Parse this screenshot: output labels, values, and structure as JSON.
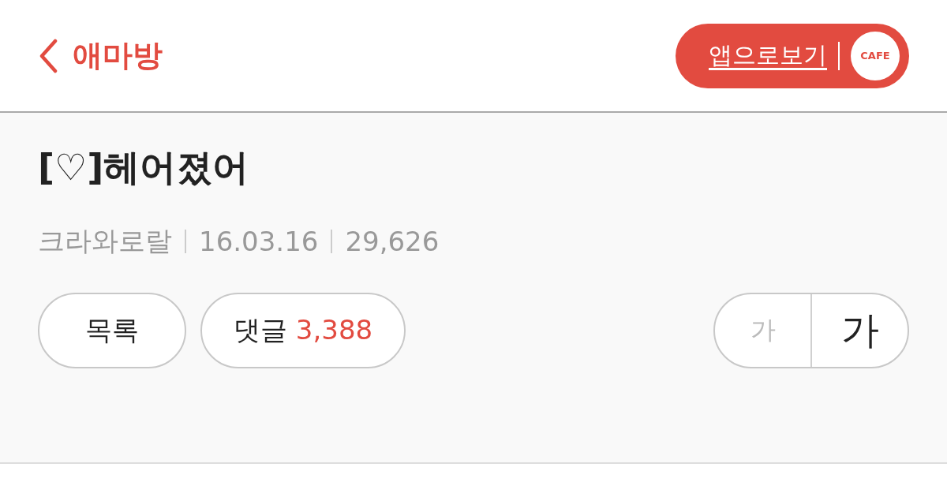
{
  "header": {
    "back_label": "애마방",
    "app_button": {
      "label": "앱으로보기",
      "logo_text": "CAFE"
    }
  },
  "post": {
    "title": "[♡]헤어졌어",
    "author": "크라와로랄",
    "date": "16.03.16",
    "views": "29,626"
  },
  "actions": {
    "list_button": "목록",
    "comments_button": {
      "label": "댓글",
      "count": "3,388"
    }
  },
  "font_size": [
    {
      "label": "가",
      "kind": "small",
      "disabled": true
    },
    {
      "label": "가",
      "kind": "large",
      "disabled": false
    }
  ]
}
